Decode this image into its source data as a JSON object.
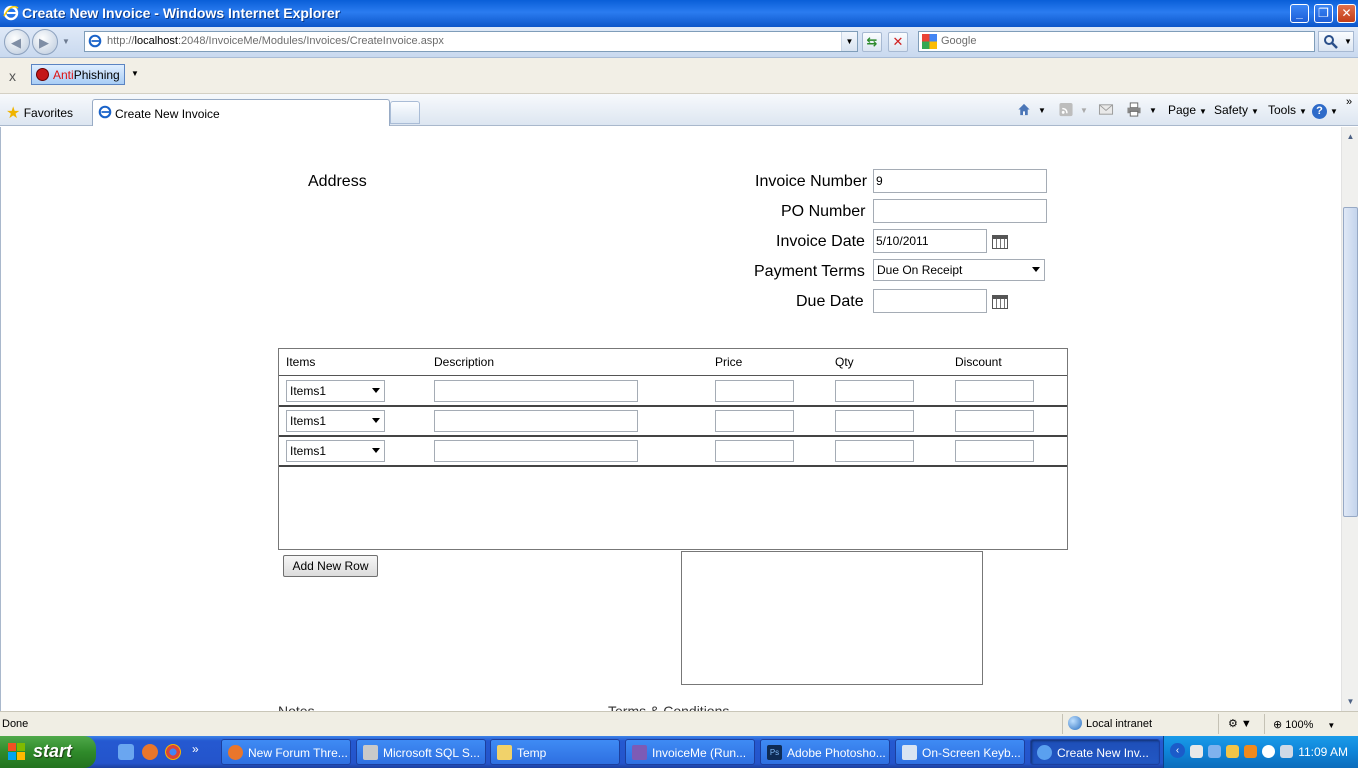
{
  "window": {
    "title": "Create New Invoice - Windows Internet Explorer",
    "minimize": "_",
    "restore": "❐",
    "close": "✕"
  },
  "addressbar": {
    "url_prefix": "http://",
    "url_host": "localhost",
    "url_rest": ":2048/InvoiceMe/Modules/Invoices/CreateInvoice.aspx",
    "search_placeholder": "Google"
  },
  "toolbar": {
    "close": "x",
    "antiphishing_a": "Anti",
    "antiphishing_b": "Phishing"
  },
  "tabs": {
    "favorites": "Favorites",
    "active_tab": "Create New Invoice"
  },
  "commandbar": {
    "page": "Page",
    "safety": "Safety",
    "tools": "Tools",
    "help": "?"
  },
  "form": {
    "address_label": "Address",
    "invoice_number_label": "Invoice Number",
    "invoice_number_value": "9",
    "po_number_label": "PO Number",
    "po_number_value": "",
    "invoice_date_label": "Invoice Date",
    "invoice_date_value": "5/10/2011",
    "payment_terms_label": "Payment Terms",
    "payment_terms_value": "Due On Receipt",
    "due_date_label": "Due Date",
    "due_date_value": ""
  },
  "items_table": {
    "headers": [
      "Items",
      "Description",
      "Price",
      "Qty",
      "Discount"
    ],
    "rows": [
      {
        "item": "Items1",
        "description": "",
        "price": "",
        "qty": "",
        "discount": ""
      },
      {
        "item": "Items1",
        "description": "",
        "price": "",
        "qty": "",
        "discount": ""
      },
      {
        "item": "Items1",
        "description": "",
        "price": "",
        "qty": "",
        "discount": ""
      }
    ]
  },
  "add_row_button": "Add New Row",
  "cut_labels": {
    "notes": "Notes",
    "terms": "Terms & Conditions"
  },
  "statusbar": {
    "status": "Done",
    "zone": "Local intranet",
    "zoom": "100%"
  },
  "taskbar": {
    "start": "start",
    "buttons": [
      "New Forum Thre...",
      "Microsoft SQL S...",
      "Temp",
      "InvoiceMe (Run...",
      "Adobe Photosho...",
      "On-Screen Keyb...",
      "Create New Inv..."
    ],
    "clock": "11:09 AM"
  },
  "colors": {
    "titlebar": "#0a5fd8",
    "taskbar": "#2454cb",
    "start_button": "#2f8a2a",
    "tray": "#0e84d8"
  }
}
